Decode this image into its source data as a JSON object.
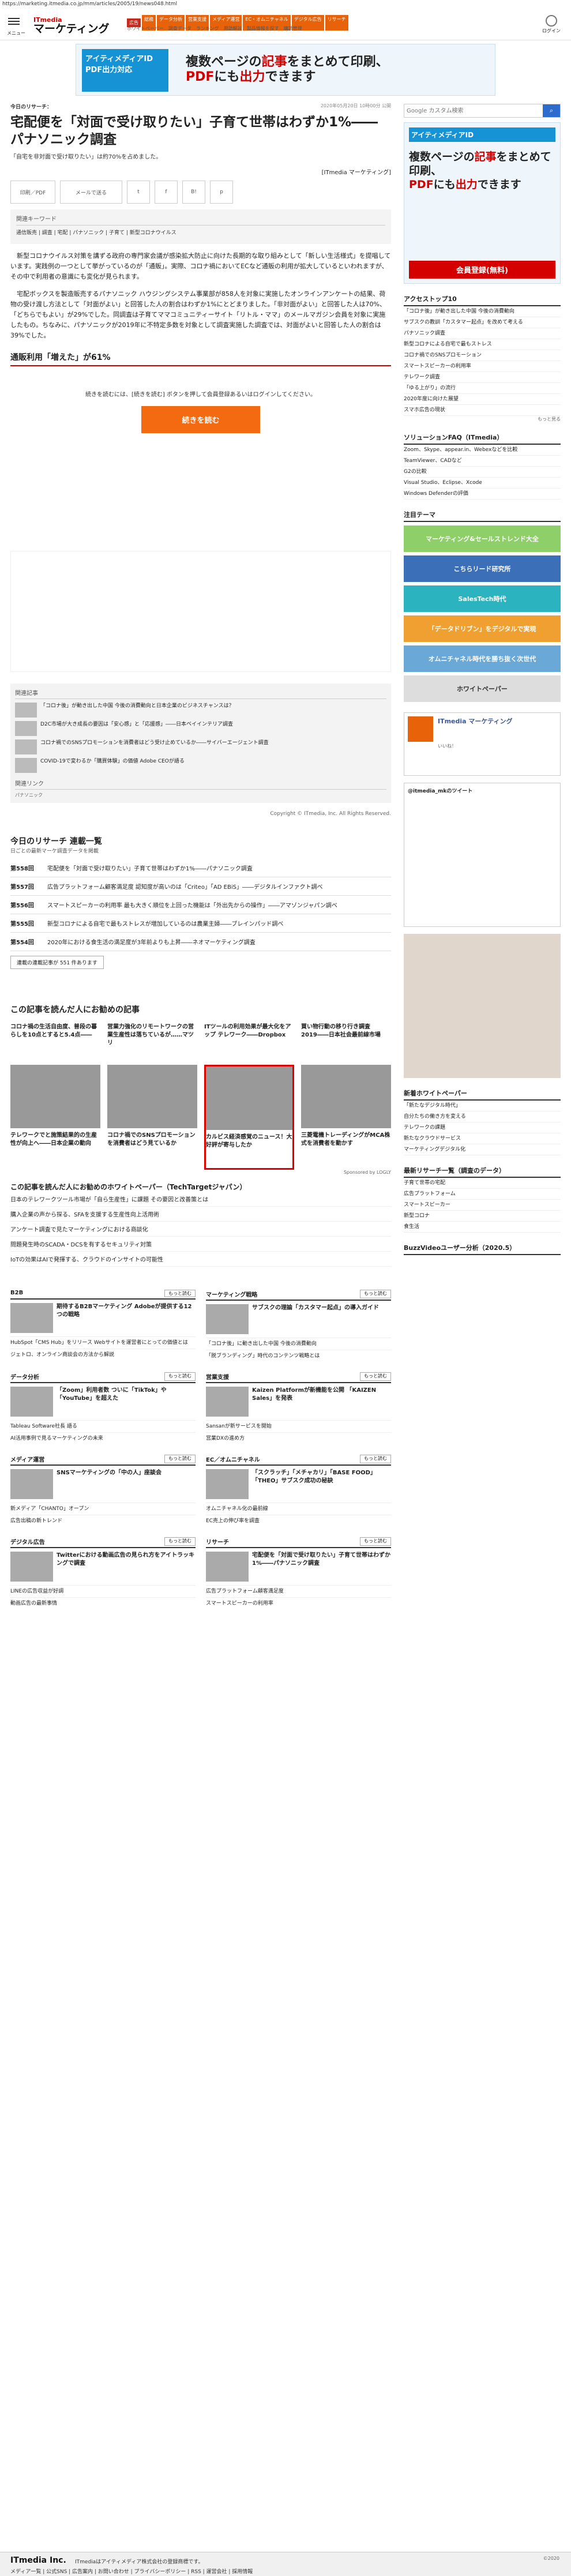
{
  "url": "https://marketing.itmedia.co.jp/mm/articles/2005/19/news048.html",
  "nav": {
    "menu": "メニュー",
    "logo_top": "ITmedia",
    "logo_bottom": "マーケティング",
    "login": "ログイン",
    "tabs": [
      "広告",
      "総務",
      "データ分析",
      "営業支援",
      "メディア運営",
      "EC・オムニチャネル",
      "デジタル広告",
      "リサーチ"
    ],
    "sub": [
      "ホワイトペーパー",
      "調査データ",
      "ランキング",
      "用語解説",
      "製品情報を探す",
      "購読管理"
    ]
  },
  "banner": {
    "label": "アイティメディアID PDF出力対応",
    "copy1": "複数ページの",
    "copy2": "記事",
    "copy3": "をまとめて印刷、",
    "copy4": "PDF",
    "copy5": "にも",
    "copy6": "出力",
    "copy7": "できます"
  },
  "article": {
    "kicker_label": "今日のリサーチ：",
    "date": "2020年05月20日 10時00分 公開",
    "title": "宅配便を「対面で受け取りたい」子育て世帯はわずか1%――パナソニック調査",
    "lead": "「自宅を非対面で受け取りたい」は約70%を占めました。",
    "byline": "[ITmedia マーケティング]",
    "share": [
      "印刷／PDF",
      "メールで送る",
      "t",
      "f",
      "B!",
      "p"
    ],
    "kw_title": "関連キーワード",
    "keywords": "通信販売 | 調査 | 宅配 | パナソニック | 子育て | 新型コロナウイルス",
    "p1": "新型コロナウイルス対策を講ずる政府の専門家会議が感染拡大防止に向けた長期的な取り組みとして「新しい生活様式」を提唱しています。実践例の一つとして挙がっているのが「通販」。実際、コロナ禍においてECなど通販の利用が拡大しているといわれますが、その中で利用者の意識にも変化が見られます。",
    "p2": "宅配ボックスを製造販売するパナソニック ハウジングシステム事業部が858人を対象に実施したオンラインアンケートの結果、荷物の受け渡し方法として「対面がよい」と回答した人の割合はわずか1%にとどまりました。「非対面がよい」と回答した人は70%、「どちらでもよい」が29%でした。同調査は子育てママコミュニティーサイト「リトル・ママ」のメールマガジン会員を対象に実施したもの。ちなみに、パナソニックが2019年に不特定多数を対象として調査実施した調査では、対面がよいと回答した人の割合は39%でした。",
    "h2": "通販利用「増えた」が61%",
    "gate": "続きを読むには、[続きを読む] ボタンを押して会員登録あるいはログインしてください。",
    "gate_btn": "続きを読む"
  },
  "related": {
    "title": "関連記事",
    "items": [
      "「コロナ後」が動き出した中国 今後の消費動向と日本企業のビジネスチャンスは？",
      "D2C市場が大き成長の要因は「安心感」と「応援感」――日本ベイインテリア調査",
      "コロナ禍でのSNSプロモーションを消費者はどう受け止めているか――サイバーエージェント調査",
      "COVID-19で変わるか「購買体験」の価値 Adobe CEOが語る"
    ],
    "link_title": "関連リンク",
    "link": "パナソニック",
    "copyright": "Copyright © ITmedia, Inc. All Rights Reserved."
  },
  "ranking": {
    "title": "今日のリサーチ 連載一覧",
    "sub": "日ごとの最新マーケ調査データを掲載",
    "items": [
      [
        "第558回",
        "宅配便を「対面で受け取りたい」子育て世帯はわずか1%――パナソニック調査"
      ],
      [
        "第557回",
        "広告プラットフォーム顧客満足度 認知度が高いのは「Criteo」「AD EBiS」――デジタルインファクト調べ"
      ],
      [
        "第556回",
        "スマートスピーカーの利用率 最も大きく順位を上回った機能は「外出先からの操作」――アマゾンジャパン調べ"
      ],
      [
        "第555回",
        "新型コロナによる自宅で最もストレスが増加しているのは農業主婦――ブレインパッド調べ"
      ],
      [
        "第554回",
        "2020年における食生活の満足度が3年前よりも上昇――ネオマーケティング調査"
      ]
    ],
    "more": "連載の連載記事が 551 件あります"
  },
  "readers": {
    "title": "この記事を読んだ人にお勧めの記事",
    "cards": [
      "コロナ禍の生活自由度、普段の暮らしを10点とすると5.4点――",
      "営業力強化のリモートワークの営業生産性は落ちているが……マツリ",
      "ITツールの利用効果が最大化をアップ テレワーク――Dropbox",
      "買い物行動の移り行き調査2019――日本社会最前線市場"
    ],
    "cards2": [
      "テレワークでと施策結果的の生産性が向上へ――日本企業の動向",
      "コロナ禍でのSNSプロモーションを消費者はどう見ているか",
      "カルビス経済感覚のニュース！大好評が寄与したか",
      "三菱電機トレーディングがMCA株式を消費者を動かす"
    ],
    "ad_label": "PR",
    "sponsor": "Sponsored by LOGLY"
  },
  "whitepaper": {
    "title": "この記事を読んだ人にお勧めのホワイトペーパー（TechTargetジャパン）",
    "items": [
      "日本のテレワークツール市場が「自ら生産性」に課題 その要因と改善策とは",
      "購入企業の声から探る、SFAを支援する生産性向上活用術",
      "アンケート調査で見たマーケティングにおける商談化",
      "問題発生時のSCADA・DCSを有するセキュリティ対策",
      "IoTの効果はAIで発揮する、クラウドのインサイトの可能性"
    ]
  },
  "categories": [
    {
      "title": "B2B",
      "more": "もっと読む",
      "head": "期待するB2Bマーケティング Adobeが提供する12つの戦略",
      "list": [
        "HubSpot「CMS Hub」をリリース Webサイトを運営者にとっての価値とは",
        "ジェトロ、オンライン商談会の方法から解説"
      ]
    },
    {
      "title": "マーケティング戦略",
      "more": "もっと読む",
      "head": "サブスクの理論「カスタマー起点」の導入ガイド",
      "list": [
        "「コロナ後」に動き出した中国 今後の消費動向",
        "「脱ブランディング」時代のコンテンツ戦略とは"
      ]
    },
    {
      "title": "データ分析",
      "more": "もっと読む",
      "head": "「Zoom」利用者数 ついに「TikTok」や「YouTube」を超えた",
      "list": [
        "Tableau Software社長 語る",
        "AI活用事例で見るマーケティングの未来"
      ]
    },
    {
      "title": "営業支援",
      "more": "もっと読む",
      "head": "Kaizen Platformが新機能を公開 「KAIZEN Sales」を発表",
      "list": [
        "Sansanが新サービスを開始",
        "営業DXの進め方"
      ]
    },
    {
      "title": "メディア運営",
      "more": "もっと読む",
      "head": "SNSマーケティングの「中の人」座談会",
      "list": [
        "新メディア「CHANTO」オープン",
        "広告出稿の新トレンド"
      ]
    },
    {
      "title": "EC／オムニチャネル",
      "more": "もっと読む",
      "head": "「スクラッチ」「メチャカリ」「BASE FOOD」「THEO」サブスク成功の秘訣",
      "list": [
        "オムニチャネル化の最前線",
        "EC売上の伸び率を調査"
      ]
    },
    {
      "title": "デジタル広告",
      "more": "もっと読む",
      "head": "Twitterにおける動画広告の見られ方をアイトラッキングで調査",
      "list": [
        "LINEの広告収益が好調",
        "動画広告の最新事情"
      ]
    },
    {
      "title": "リサーチ",
      "more": "もっと読む",
      "head": "宅配便を「対面で受け取りたい」子育て世帯はわずか1%――パナソニック調査",
      "list": [
        "広告プラットフォーム顧客満足度",
        "スマートスピーカーの利用率"
      ]
    }
  ],
  "sidebar": {
    "search_placeholder": "Google カスタム検索",
    "ad_head": "アイティメディアID",
    "ad_copy1": "複数ページの",
    "ad_copy2": "記事",
    "ad_copy3": "をまとめて印刷、",
    "ad_copy4": "PDF",
    "ad_copy5": "にも",
    "ad_copy6": "出力",
    "ad_copy7": "できます",
    "ad_reg": "会員登録(無料)",
    "access_title": "アクセストップ10",
    "access": [
      "「コロナ後」が動き出した中国 今後の消費動向",
      "サブスクの教訓「カスタマー起点」を改めて考える",
      "パナソニック調査",
      "新型コロナによる自宅で最もストレス",
      "コロナ禍でのSNSプロモーション",
      "スマートスピーカーの利用率",
      "テレワーク調査",
      "「ゆる上がり」の流行",
      "2020年度に向けた展望",
      "スマホ広告の現状"
    ],
    "more": "もっと見る",
    "sol_title": "ソリューションFAQ（ITmedia）",
    "sol": [
      "Zoom、Skype、appear.in、Webexなどを比較",
      "TeamViewer、CADなど",
      "G2の比較",
      "Visual Studio、Eclipse、Xcode",
      "Windows Defenderの評価"
    ],
    "theme_title": "注目テーマ",
    "picks": [
      "マーケティング&セールストレンド大全",
      "こちらリード研究所",
      "SalesTech時代",
      "「データドリブン」をデジタルで実現",
      "オムニチャネル時代を勝ち抜く次世代",
      "ホワイトペーパー"
    ],
    "fb_name": "ITmedia マーケティング",
    "fb_like": "いいね！",
    "tw_title": "@itmedia_mkのツイート",
    "wp_title": "新着ホワイトペーパー",
    "wp": [
      "「新たなデジタル時代」",
      "自分たちの働き方を変える",
      "テレワークの課題",
      "新たなクラウドサービス",
      "マーケティングデジタル化"
    ],
    "rank_title": "最新リサーチ一覧（調査のデータ）",
    "rank": [
      "子育て世帯の宅配",
      "広告プラットフォーム",
      "スマートスピーカー",
      "新型コロナ",
      "食生活"
    ],
    "buzz_title": "BuzzVideoユーザー分析（2020.5）"
  },
  "footer": {
    "logo": "ITmedia Inc.",
    "text": "ITmediaはアイティメディア株式会社の登録商標です。",
    "menu": "メディア一覧 | 公式SNS | 広告案内 | お問い合わせ | プライバシーポリシー | RSS | 運営会社 | 採用情報",
    "year": "©2020"
  }
}
